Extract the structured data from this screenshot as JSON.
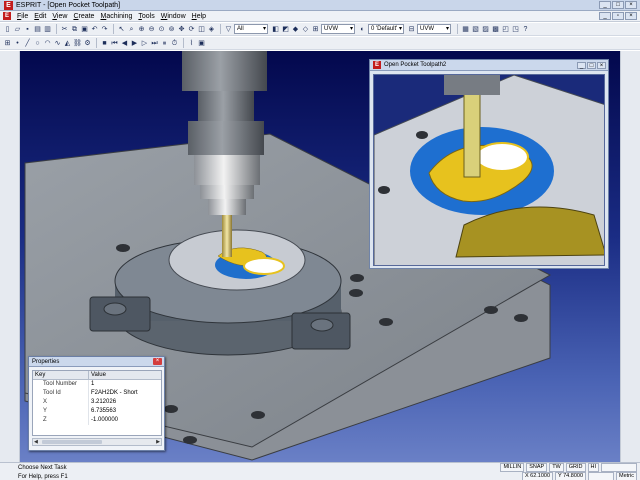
{
  "window": {
    "title": "ESPRIT - [Open Pocket Toolpath]",
    "logo": "E"
  },
  "menu": {
    "items": [
      "File",
      "Edit",
      "View",
      "Create",
      "Machining",
      "Tools",
      "Window",
      "Help"
    ]
  },
  "toolbar": {
    "filter_combo": "All",
    "workplane_combo": "UVW",
    "layer_combo": "0 'Default'",
    "workplane_combo2": "UVW"
  },
  "subwindow": {
    "title": "Open Pocket Toolpath2"
  },
  "properties": {
    "title": "Properties",
    "columns": [
      "Key",
      "Value"
    ],
    "rows": [
      {
        "key": "Tool Number",
        "value": "1"
      },
      {
        "key": "Tool Id",
        "value": "F2AH2DK - Short"
      },
      {
        "key": "X",
        "value": "3.212026"
      },
      {
        "key": "Y",
        "value": "6.735563"
      },
      {
        "key": "Z",
        "value": "-1.000000"
      }
    ]
  },
  "status": {
    "task": "Choose Next Task",
    "help": "For Help, press F1",
    "modes": [
      "MILLIN",
      "SNAP",
      "TW",
      "GRID",
      "HI"
    ],
    "x": "X 62.1000",
    "y": "Y 74.8000",
    "units": "Metric"
  },
  "colors": {
    "viewport_top": "#03084d",
    "viewport_bottom": "#6a80c6",
    "toolpath": "#e7c21e",
    "stock_cut": "#1e6fd0",
    "brand": "#c21c1c"
  }
}
